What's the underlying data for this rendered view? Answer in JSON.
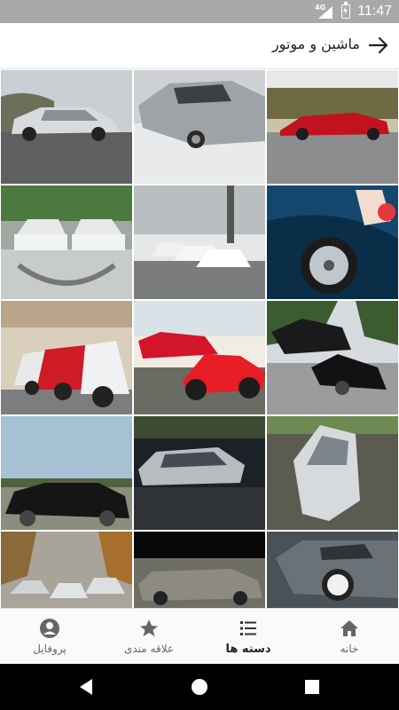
{
  "status_bar": {
    "network": "4G",
    "time": "11:47"
  },
  "app_bar": {
    "title": "ماشین و موتور",
    "back_icon": "arrow-right-icon"
  },
  "gallery": {
    "images": [
      {
        "label": "silver-sedan-side"
      },
      {
        "label": "silver-lowered-sedan"
      },
      {
        "label": "red-coupe-road"
      },
      {
        "label": "white-cars-mirrored"
      },
      {
        "label": "white-cars-parked"
      },
      {
        "label": "blue-car-wheel-cleaning"
      },
      {
        "label": "hatchbacks-open-trunks"
      },
      {
        "label": "red-car-motorcycle"
      },
      {
        "label": "black-cars-road"
      },
      {
        "label": "black-sedan-lowered"
      },
      {
        "label": "silver-sedan-night"
      },
      {
        "label": "silver-sedan-tilted"
      },
      {
        "label": "cars-street-row"
      },
      {
        "label": "grey-sedan-dark"
      },
      {
        "label": "grey-sedan-chrome-wheels"
      }
    ]
  },
  "bottom_nav": {
    "items": [
      {
        "label": "پروفایل",
        "icon": "profile-icon"
      },
      {
        "label": "علاقه مندی",
        "icon": "star-icon"
      },
      {
        "label": "دسته ها",
        "icon": "list-icon"
      },
      {
        "label": "خانه",
        "icon": "home-icon"
      }
    ]
  },
  "colors": {
    "status_bar": "#a9a9a9",
    "nav_background": "#fafafa",
    "system_nav": "#000000"
  }
}
